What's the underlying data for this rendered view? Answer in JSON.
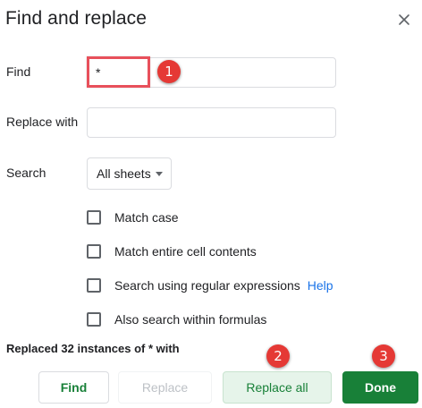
{
  "dialog": {
    "title": "Find and replace",
    "close_icon": "close-icon"
  },
  "find": {
    "label": "Find",
    "value": "*"
  },
  "replace": {
    "label": "Replace with",
    "value": ""
  },
  "search": {
    "label": "Search",
    "selected": "All sheets"
  },
  "options": [
    {
      "label": "Match case",
      "checked": false
    },
    {
      "label": "Match entire cell contents",
      "checked": false
    },
    {
      "label": "Search using regular expressions",
      "checked": false,
      "link": "Help"
    },
    {
      "label": "Also search within formulas",
      "checked": false
    }
  ],
  "status": "Replaced 32 instances of * with",
  "buttons": {
    "find": "Find",
    "replace": "Replace",
    "replace_all": "Replace all",
    "done": "Done"
  },
  "annotations": {
    "callout_1": "1",
    "callout_2": "2",
    "callout_3": "3",
    "color": "#e53935"
  },
  "colors": {
    "accent_green": "#188038",
    "link_blue": "#1a73e8",
    "highlight_red": "#e8505b"
  }
}
